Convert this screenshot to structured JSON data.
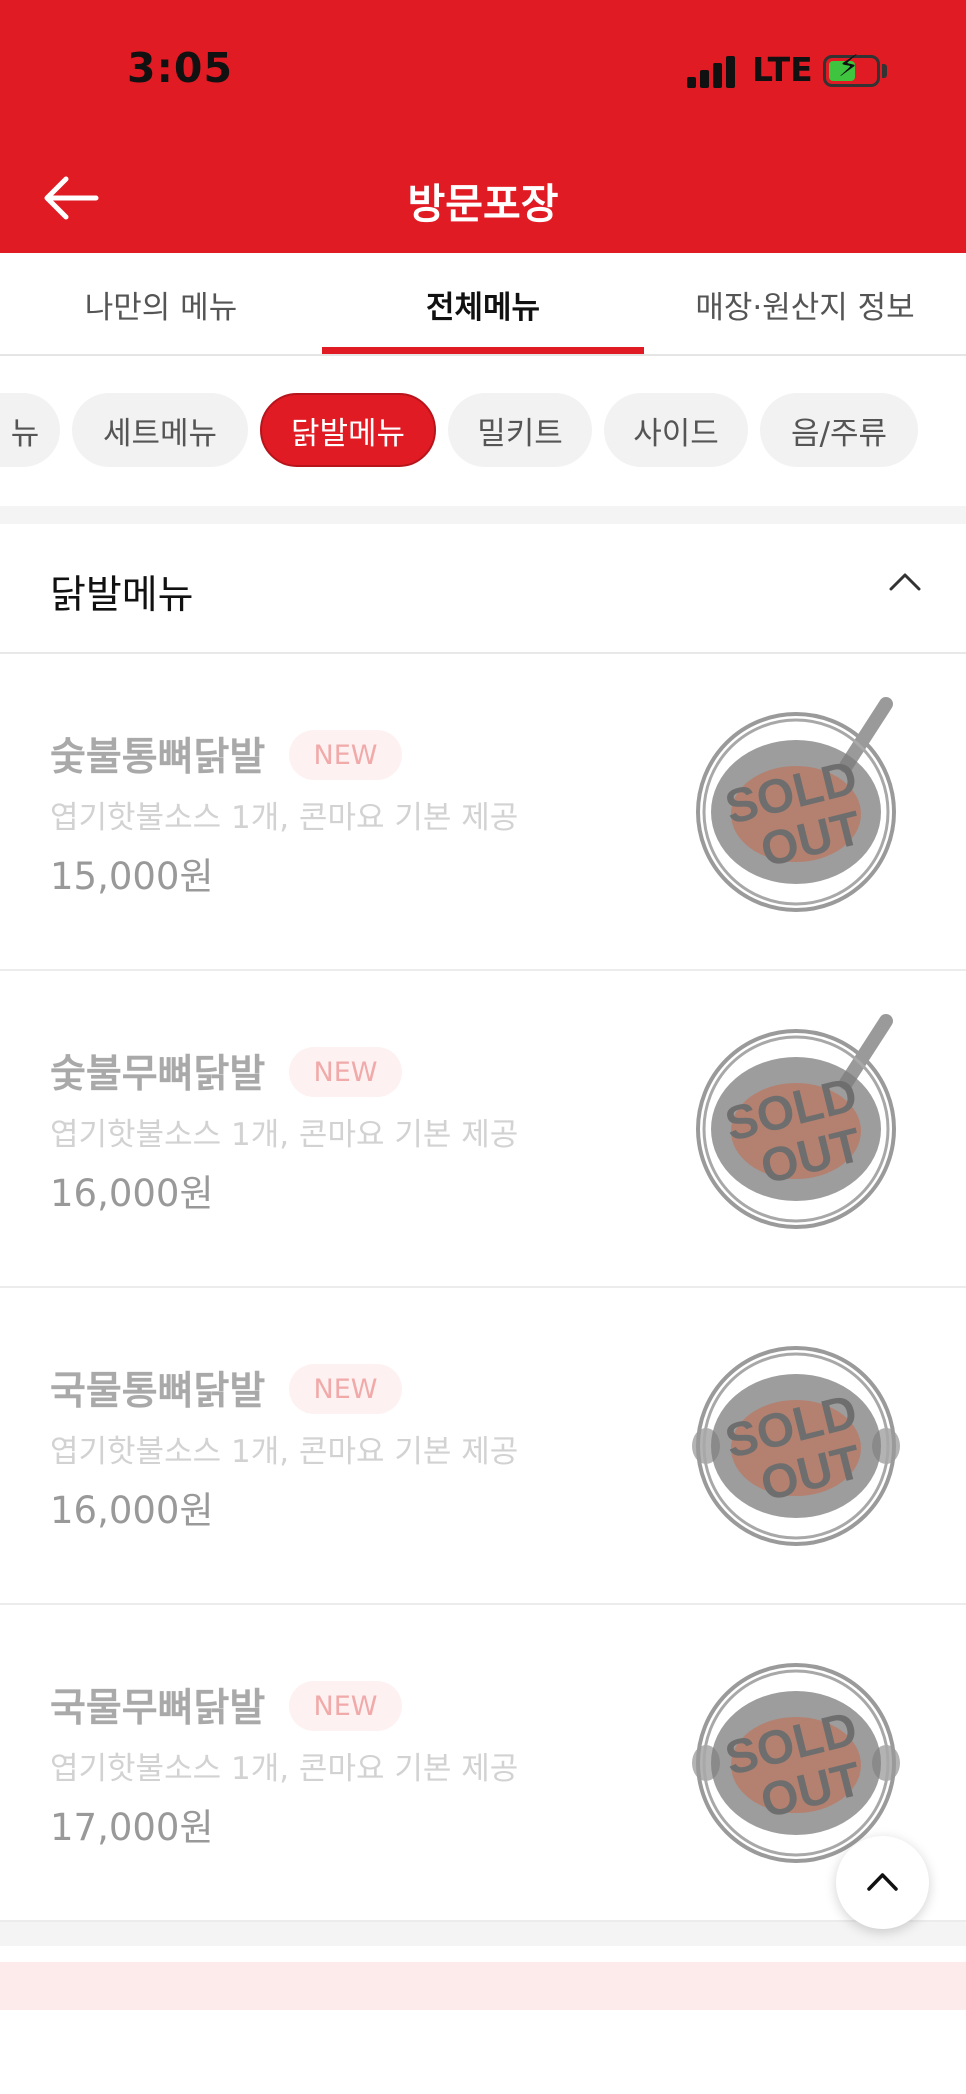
{
  "status_bar": {
    "time": "3:05",
    "network": "LTE"
  },
  "header": {
    "title": "방문포장",
    "back_icon": "arrow-left-icon"
  },
  "tabs": [
    {
      "label": "나만의 메뉴"
    },
    {
      "label": "전체메뉴"
    },
    {
      "label": "매장·원산지 정보"
    }
  ],
  "active_tab": "전체메뉴",
  "chips": [
    {
      "label": "뉴"
    },
    {
      "label": "세트메뉴"
    },
    {
      "label": "닭발메뉴"
    },
    {
      "label": "밀키트"
    },
    {
      "label": "사이드"
    },
    {
      "label": "음/주류"
    }
  ],
  "active_chip": "닭발메뉴",
  "section": {
    "title": "닭발메뉴",
    "toggle_icon": "chevron-up-icon"
  },
  "items": [
    {
      "name": "숯불통뼈닭발",
      "badge": "NEW",
      "desc": "엽기핫불소스 1개, 콘마요 기본 제공",
      "price": "15,000원",
      "status": "SOLD OUT",
      "dish": "pan"
    },
    {
      "name": "숯불무뼈닭발",
      "badge": "NEW",
      "desc": "엽기핫불소스 1개, 콘마요 기본 제공",
      "price": "16,000원",
      "status": "SOLD OUT",
      "dish": "pan"
    },
    {
      "name": "국물통뼈닭발",
      "badge": "NEW",
      "desc": "엽기핫불소스 1개, 콘마요 기본 제공",
      "price": "16,000원",
      "status": "SOLD OUT",
      "dish": "pot"
    },
    {
      "name": "국물무뼈닭발",
      "badge": "NEW",
      "desc": "엽기핫불소스 1개, 콘마요 기본 제공",
      "price": "17,000원",
      "status": "SOLD OUT",
      "dish": "pot"
    }
  ],
  "scroll_top_icon": "chevron-up-icon",
  "colors": {
    "brand": "#e01b24",
    "badge_bg": "#fdf1f1",
    "badge_text": "#f1aaaa"
  }
}
